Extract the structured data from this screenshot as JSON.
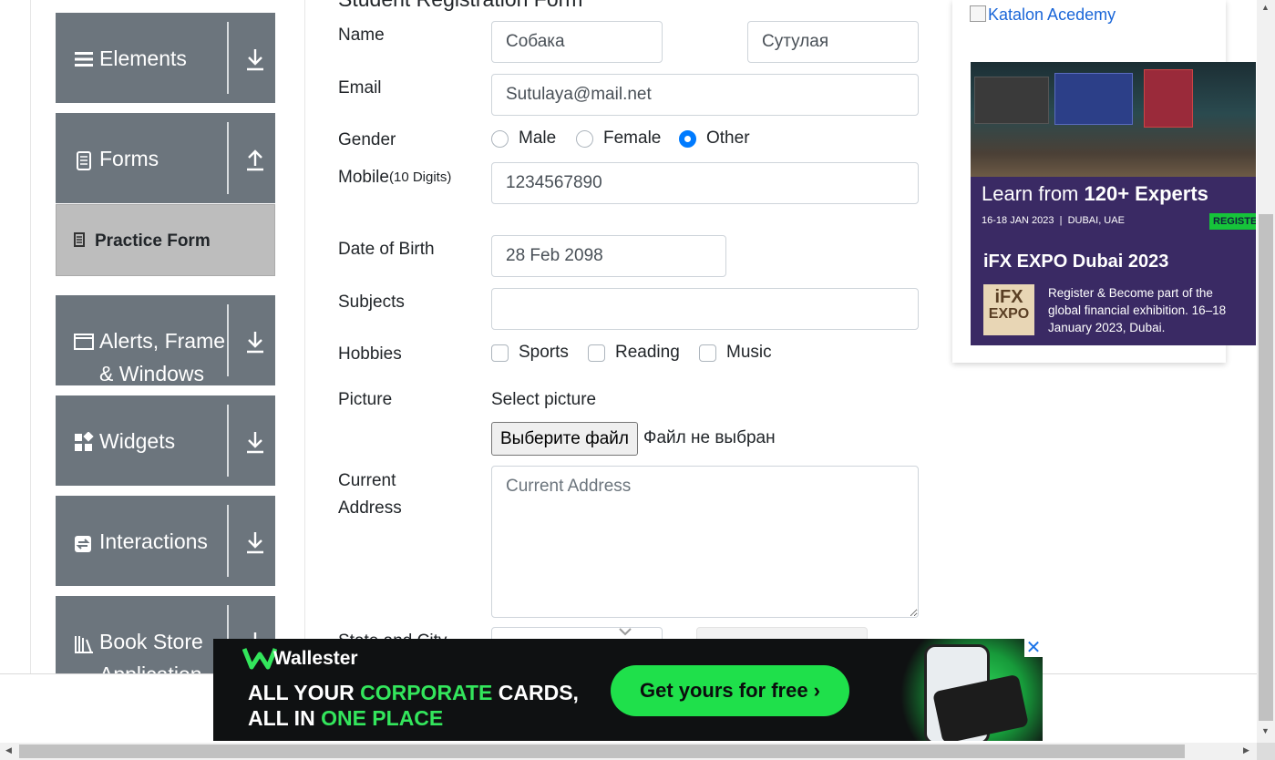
{
  "sidebar": {
    "groups": [
      {
        "label": "Elements",
        "icon": "menu-icon",
        "arrow": "arrow-down-icon"
      },
      {
        "label": "Forms",
        "icon": "document-icon",
        "arrow": "arrow-up-icon"
      },
      {
        "label": "Alerts, Frame & Windows",
        "icon": "window-icon",
        "arrow": "arrow-down-icon"
      },
      {
        "label": "Widgets",
        "icon": "widgets-icon",
        "arrow": "arrow-down-icon"
      },
      {
        "label": "Interactions",
        "icon": "interactions-icon",
        "arrow": "arrow-down-icon"
      },
      {
        "label": "Book Store Application",
        "icon": "books-icon",
        "arrow": "arrow-down-icon"
      }
    ],
    "active_item": "Practice Form"
  },
  "form": {
    "title": "Student Registration Form",
    "name_label": "Name",
    "first_name": "Собака",
    "last_name": "Сутулая",
    "email_label": "Email",
    "email": "Sutulaya@mail.net",
    "gender_label": "Gender",
    "genders": [
      "Male",
      "Female",
      "Other"
    ],
    "gender_selected": "Other",
    "mobile_label": "Mobile",
    "mobile_hint": "(10 Digits)",
    "mobile": "1234567890",
    "dob_label": "Date of Birth",
    "dob": "28 Feb 2098",
    "subjects_label": "Subjects",
    "subjects": "",
    "hobbies_label": "Hobbies",
    "hobbies": [
      "Sports",
      "Reading",
      "Music"
    ],
    "picture_label": "Picture",
    "select_picture": "Select picture",
    "file_button": "Выберите файл",
    "file_status": "Файл не выбран",
    "address_label_1": "Current",
    "address_label_2": "Address",
    "address_placeholder": "Current Address",
    "state_city_label": "State and City"
  },
  "right_ad": {
    "katalon_alt": "Katalon Acedemy",
    "heading_prefix": "Learn from",
    "heading_bold": "120+ Experts",
    "dates": "16-18 JAN 2023  |  DUBAI, UAE",
    "register": "REGISTER",
    "event": "iFX EXPO Dubai 2023",
    "logo_text_1": "iFX",
    "logo_text_2": "EXPO",
    "description": "Register & Become part of the global financial exhibition. 16–18 January 2023, Dubai."
  },
  "bottom_ad": {
    "brand": "Wallester",
    "line1_a": "ALL YOUR ",
    "line1_hl": "CORPORATE",
    "line1_b": " CARDS,",
    "line2_a": "ALL IN ",
    "line2_hl": "ONE PLACE",
    "cta": "Get yours for free ›",
    "close": "✕"
  },
  "colors": {
    "sidebar_bg": "#6c757d",
    "active_bg": "#bdbdbd",
    "radio_on": "#007bff",
    "ad_accent": "#1fe04b"
  }
}
